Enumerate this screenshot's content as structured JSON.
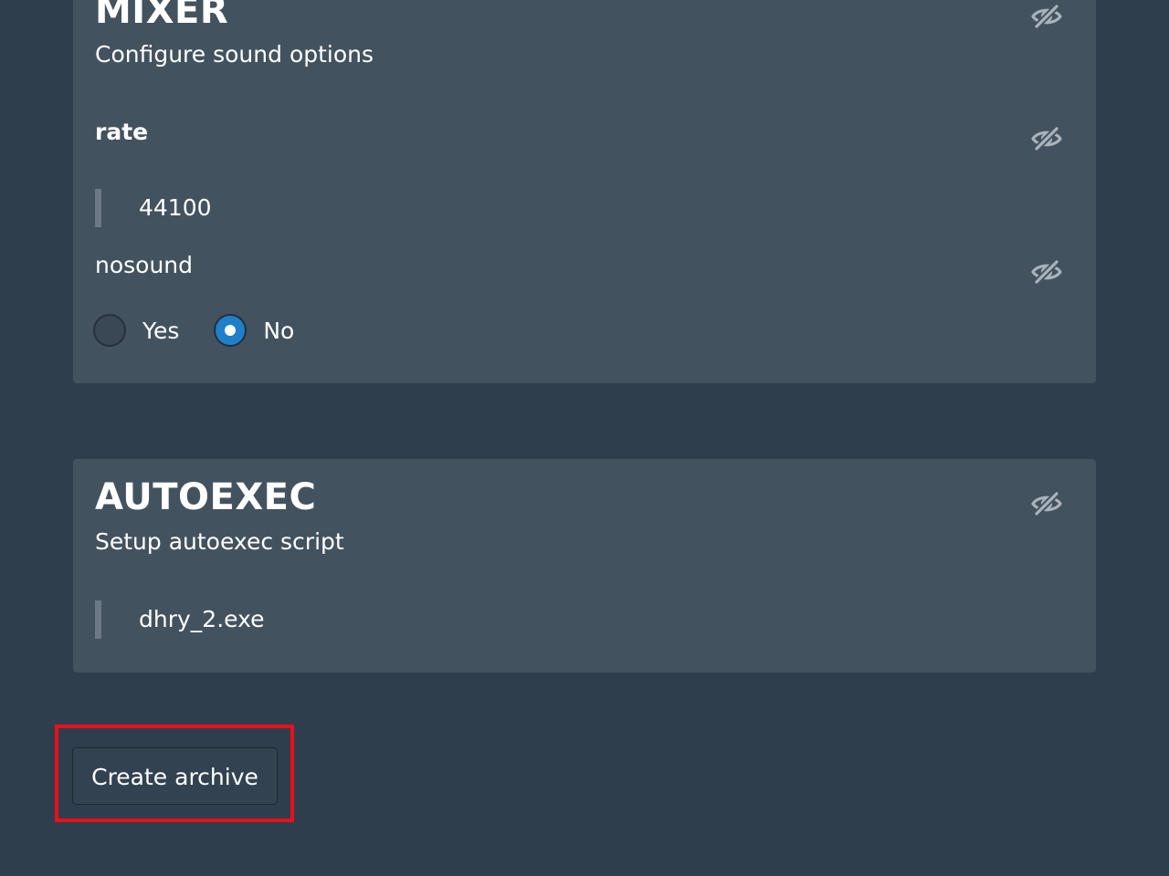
{
  "colors": {
    "page_background": "#2f3e4c",
    "card_background": "#43525f",
    "text": "#ffffff",
    "icon": "#aab3bc",
    "value_bar": "#6b7885",
    "radio_selected": "#1f7fc9",
    "highlight": "#e8101a"
  },
  "sections": {
    "mixer": {
      "title": "MIXER",
      "subtitle": "Configure sound options",
      "visibility_icon": "eye-slash-icon",
      "rate": {
        "name": "rate",
        "value": "44100",
        "visibility_icon": "eye-slash-icon"
      },
      "nosound": {
        "name": "nosound",
        "visibility_icon": "eye-slash-icon",
        "options": [
          "Yes",
          "No"
        ],
        "selected": "No"
      }
    },
    "autoexec": {
      "title": "AUTOEXEC",
      "subtitle": "Setup autoexec script",
      "visibility_icon": "eye-slash-icon",
      "script": "dhry_2.exe"
    }
  },
  "actions": {
    "create_archive_label": "Create archive"
  }
}
